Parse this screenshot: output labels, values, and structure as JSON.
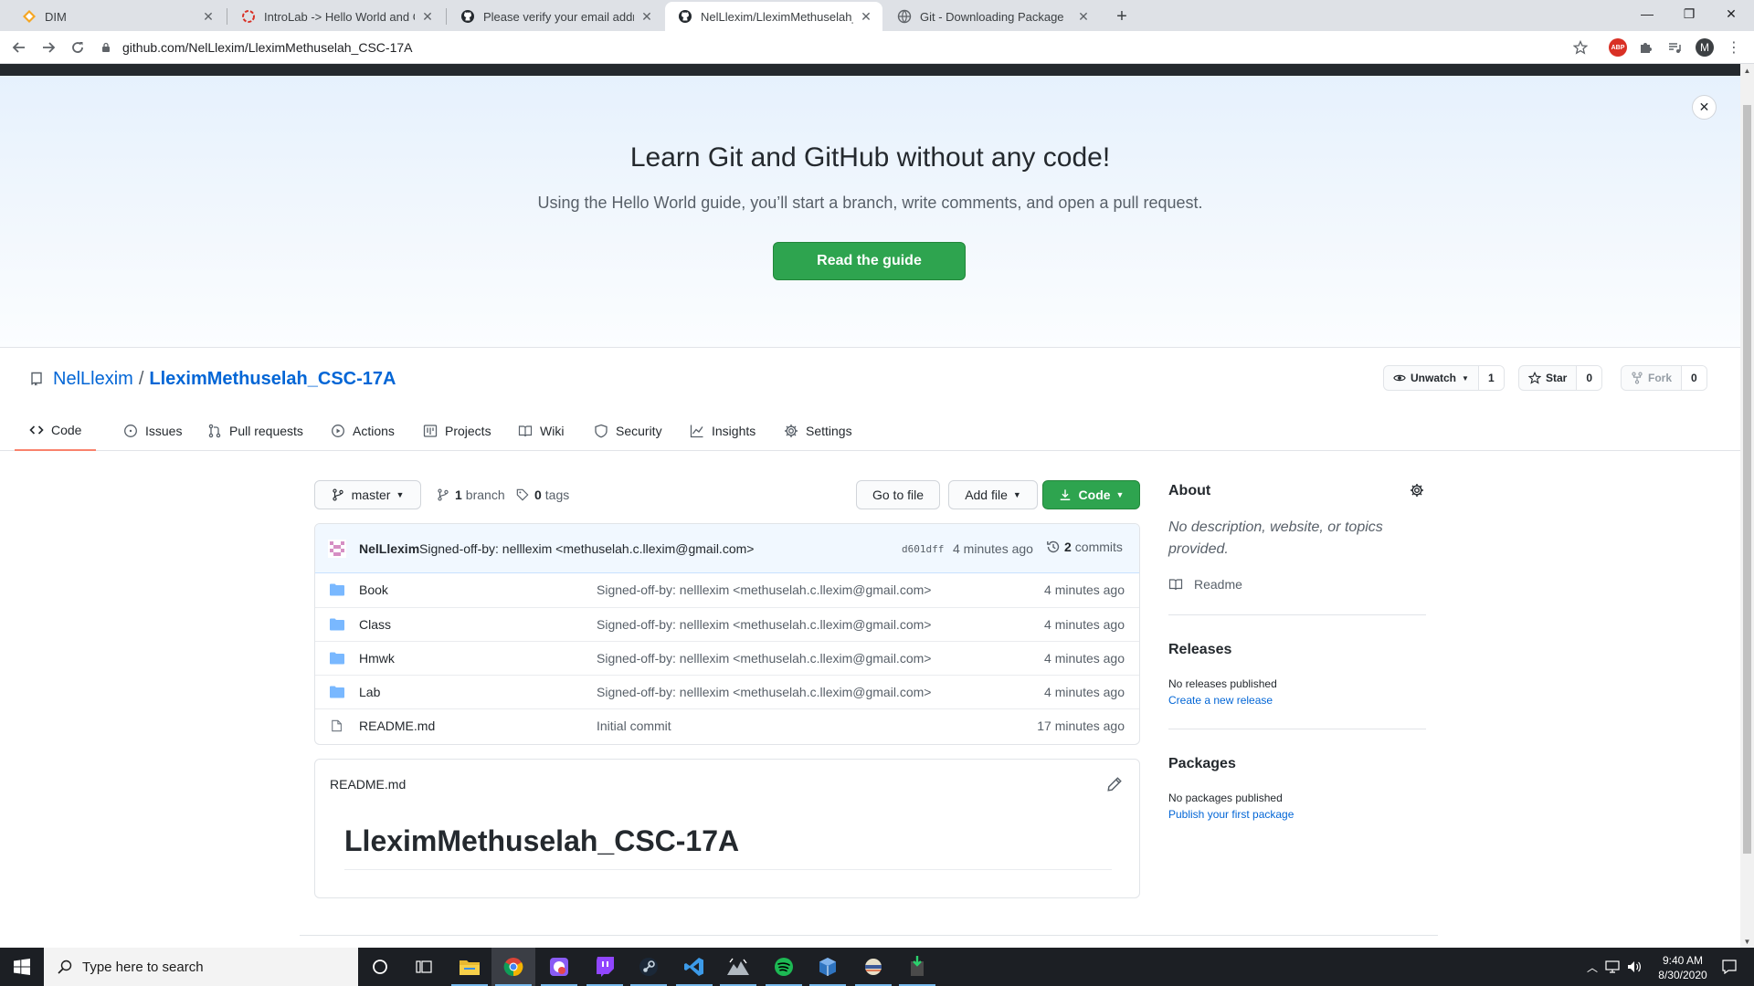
{
  "browser": {
    "tabs": [
      {
        "title": "DIM"
      },
      {
        "title": "IntroLab -> Hello World and Git"
      },
      {
        "title": "Please verify your email address"
      },
      {
        "title": "NelLlexim/LleximMethuselah_CSC"
      },
      {
        "title": "Git - Downloading Package"
      }
    ],
    "url": "github.com/NelLlexim/LleximMethuselah_CSC-17A",
    "profile_initial": "M",
    "abp_label": "ABP"
  },
  "hero": {
    "title": "Learn Git and GitHub without any code!",
    "subtitle": "Using the Hello World guide, you’ll start a branch, write comments, and open a pull request.",
    "button": "Read the guide"
  },
  "repo": {
    "owner": "NelLlexim",
    "separator": "/",
    "name": "LleximMethuselah_CSC-17A",
    "watch_label": "Unwatch",
    "watch_count": "1",
    "star_label": "Star",
    "star_count": "0",
    "fork_label": "Fork",
    "fork_count": "0"
  },
  "tabs": [
    {
      "label": "Code",
      "icon": "code-icon"
    },
    {
      "label": "Issues",
      "icon": "issue-icon"
    },
    {
      "label": "Pull requests",
      "icon": "pull-request-icon"
    },
    {
      "label": "Actions",
      "icon": "play-icon"
    },
    {
      "label": "Projects",
      "icon": "project-icon"
    },
    {
      "label": "Wiki",
      "icon": "book-icon"
    },
    {
      "label": "Security",
      "icon": "shield-icon"
    },
    {
      "label": "Insights",
      "icon": "graph-icon"
    },
    {
      "label": "Settings",
      "icon": "gear-icon"
    }
  ],
  "branch_bar": {
    "branch": "master",
    "branch_count": "1",
    "branch_word": "branch",
    "tag_count": "0",
    "tag_word": "tags",
    "go_to_file": "Go to file",
    "add_file": "Add file",
    "code": "Code"
  },
  "latest_commit": {
    "author": "NelLlexim",
    "message": "Signed-off-by: nelllexim <methuselah.c.llexim@gmail.com>",
    "sha": "d601dff",
    "time": "4 minutes ago",
    "commit_count": "2",
    "commit_word": "commits"
  },
  "files": [
    {
      "type": "folder",
      "name": "Book",
      "message": "Signed-off-by: nelllexim <methuselah.c.llexim@gmail.com>",
      "age": "4 minutes ago"
    },
    {
      "type": "folder",
      "name": "Class",
      "message": "Signed-off-by: nelllexim <methuselah.c.llexim@gmail.com>",
      "age": "4 minutes ago"
    },
    {
      "type": "folder",
      "name": "Hmwk",
      "message": "Signed-off-by: nelllexim <methuselah.c.llexim@gmail.com>",
      "age": "4 minutes ago"
    },
    {
      "type": "folder",
      "name": "Lab",
      "message": "Signed-off-by: nelllexim <methuselah.c.llexim@gmail.com>",
      "age": "4 minutes ago"
    },
    {
      "type": "file",
      "name": "README.md",
      "message": "Initial commit",
      "age": "17 minutes ago"
    }
  ],
  "readme": {
    "filename": "README.md",
    "heading": "LleximMethuselah_CSC-17A"
  },
  "sidebar": {
    "about_title": "About",
    "about_desc": "No description, website, or topics provided.",
    "readme_link": "Readme",
    "releases_title": "Releases",
    "releases_empty": "No releases published",
    "releases_link": "Create a new release",
    "packages_title": "Packages",
    "packages_empty": "No packages published",
    "packages_link": "Publish your first package"
  },
  "taskbar": {
    "search_placeholder": "Type here to search",
    "time": "9:40 AM",
    "date": "8/30/2020"
  },
  "colors": {
    "primary_green": "#2ea44f",
    "link_blue": "#0366d6",
    "tab_underline": "#f9826c",
    "folder_blue": "#79b8ff"
  }
}
